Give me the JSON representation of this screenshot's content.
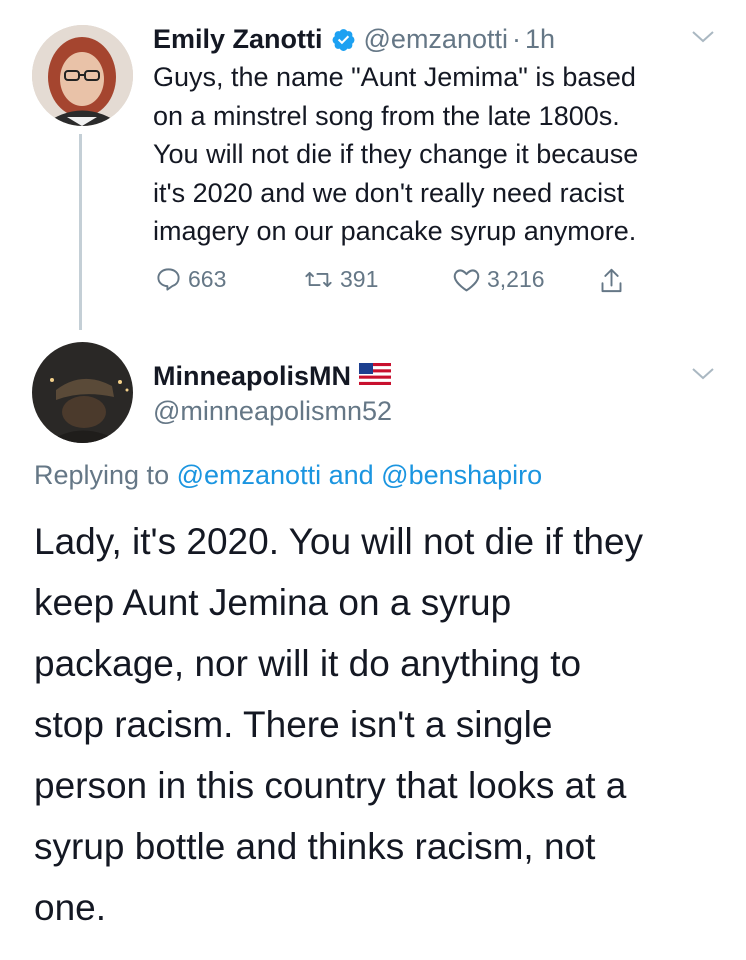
{
  "tweet1": {
    "name": "Emily Zanotti",
    "handle": "@emzanotti",
    "separator": "·",
    "time": "1h",
    "lines": [
      "Guys, the name \"Aunt Jemima\" is based",
      "on a minstrel song from the late 1800s.",
      "You will not die if they change it because",
      "it's 2020 and we don't really need racist",
      "imagery on our pancake syrup anymore."
    ],
    "replies": "663",
    "retweets": "391",
    "likes": "3,216",
    "avatar_icon": "user-avatar",
    "verified_icon": "verified-badge-icon"
  },
  "tweet2": {
    "name": "MinneapolisMN",
    "flag_icon": "us-flag-icon",
    "handle": "@minneapolismn52",
    "replying_prefix": "Replying to",
    "mention1": "@emzanotti",
    "conj": "and",
    "mention2": "@benshapiro",
    "lines": [
      "Lady, it's 2020. You will not die if they",
      "keep Aunt Jemina on a syrup",
      "package, nor will it do anything to",
      "stop racism. There isn't a single",
      "person in this country that looks at a",
      "syrup bottle and thinks racism, not",
      "one."
    ]
  },
  "colors": {
    "text": "#141823",
    "secondary": "#657786",
    "link": "#1b95e0",
    "verified": "#1da1f2"
  }
}
